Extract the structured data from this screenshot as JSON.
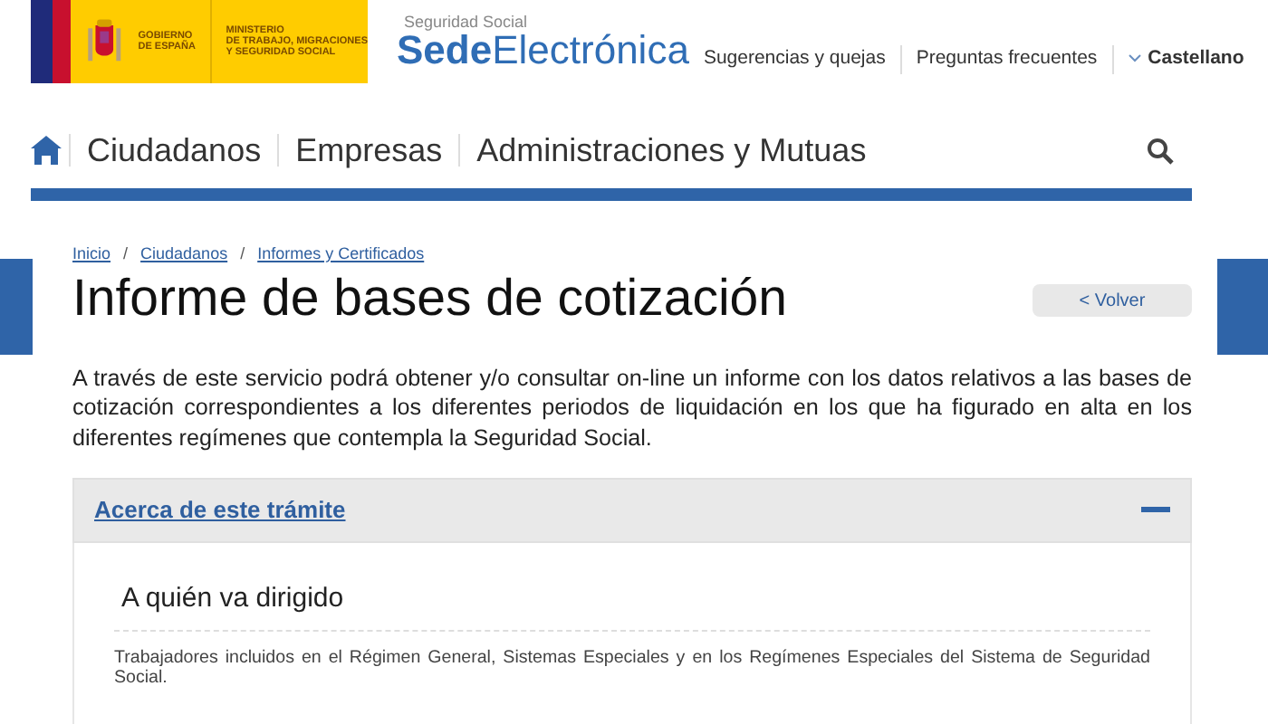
{
  "header": {
    "gov_logo": {
      "line_1": "GOBIERNO",
      "line_2": "DE ESPAÑA",
      "ministry_1": "MINISTERIO",
      "ministry_2": "DE TRABAJO, MIGRACIONES",
      "ministry_3": "Y SEGURIDAD SOCIAL"
    },
    "site_logo": {
      "caption": "Seguridad Social",
      "bold": "Sede",
      "rest": "Electrónica"
    },
    "links": [
      "Sugerencias y quejas",
      "Preguntas frecuentes"
    ],
    "language": "Castellano"
  },
  "nav": {
    "items": [
      "Ciudadanos",
      "Empresas",
      "Administraciones y Mutuas"
    ]
  },
  "breadcrumb": [
    {
      "label": "Inicio"
    },
    {
      "separator": "/",
      "label": "Ciudadanos"
    },
    {
      "separator": "/",
      "label": "Informes y Certificados"
    }
  ],
  "title": "Informe de bases de cotización",
  "back_button": "< Volver",
  "intro": "A través de este servicio podrá obtener y/o consultar on-line un informe con los datos relativos a las bases de cotización correspondientes a los diferentes periodos de liquidación en los que ha figurado en alta en los diferentes regímenes que contempla la Seguridad Social.",
  "accordion": {
    "title": "Acerca de este trámite",
    "expanded": true,
    "sections": [
      {
        "heading": "A quién va dirigido",
        "text": "Trabajadores incluidos en el Régimen General, Sistemas Especiales y en los Regímenes Especiales del Sistema de Seguridad Social."
      }
    ]
  }
}
